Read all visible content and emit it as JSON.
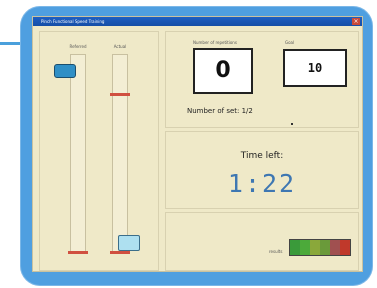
{
  "window": {
    "title": "Pinch Functional Speed Training",
    "close_label": "×"
  },
  "sliders": {
    "reference_label": "Referred",
    "actual_label": "Actual"
  },
  "counters": {
    "repetitions_label": "Number of repetitions",
    "repetitions_value": "0",
    "goal_label": "Goal",
    "goal_value": "10",
    "set_text": "Number of set: 1/2"
  },
  "timer": {
    "label": "Time left:",
    "value": "1:22"
  },
  "result": {
    "label": "results",
    "colors": [
      "#3a9a3a",
      "#4caa3a",
      "#8aa83a",
      "#6a9a3a",
      "#a05050",
      "#c0392b"
    ]
  },
  "colors": {
    "device_frame": "#4f9fe0",
    "screen_bg": "#efe9c8",
    "titlebar": "#1e5fc2",
    "reference_handle": "#2f8fc6",
    "actual_handle": "#aee0f0",
    "target_line": "#d05040",
    "timer_text": "#3e77b2"
  }
}
